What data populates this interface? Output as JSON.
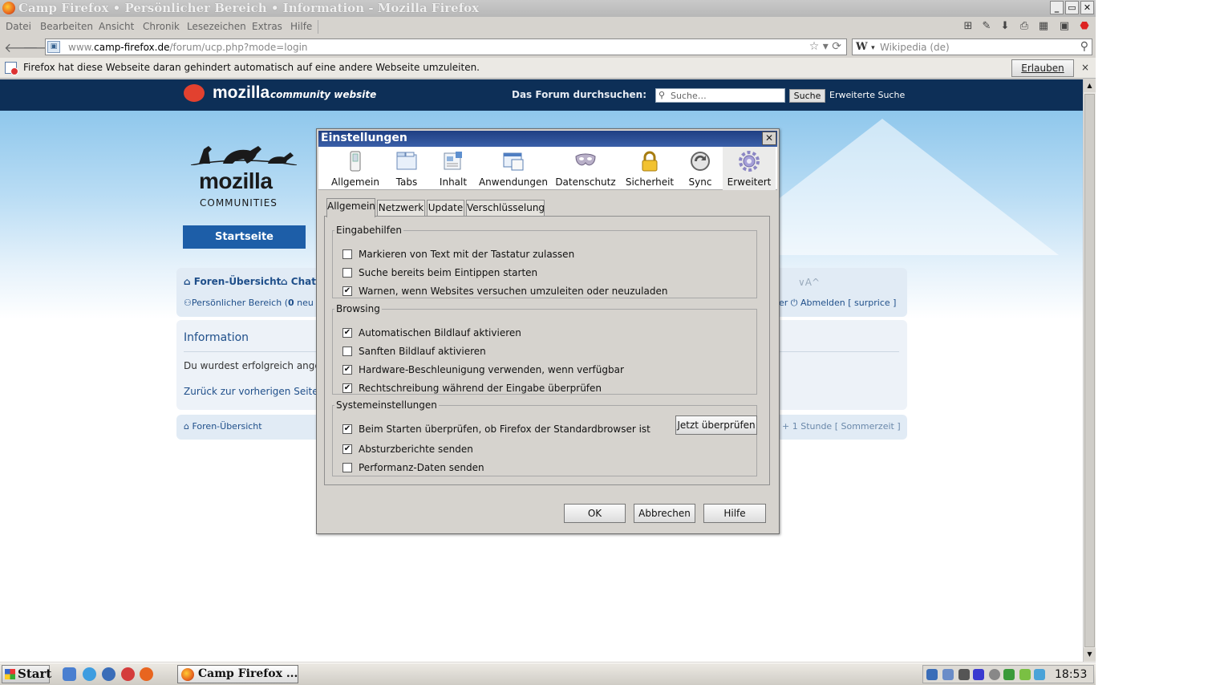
{
  "window": {
    "title": "Camp Firefox • Persönlicher Bereich • Information - Mozilla Firefox",
    "min_label": "_",
    "max_label": "▭",
    "close_label": "✕"
  },
  "menubar": {
    "items": [
      "Datei",
      "Bearbeiten",
      "Ansicht",
      "Chronik",
      "Lesezeichen",
      "Extras",
      "Hilfe"
    ]
  },
  "navbar": {
    "back": "🡐",
    "forward": "🡒",
    "url_prefix": "www.",
    "url_host": "camp-firefox.de",
    "url_path": "/forum/ucp.php?mode=login",
    "url_icons": "☆ ▾  ⟳",
    "search_engine": "W",
    "search_engine_arrow": "▾",
    "search_placeholder": "Wikipedia (de)"
  },
  "notification": {
    "text": "Firefox hat diese Webseite daran gehindert automatisch auf eine andere Webseite umzuleiten.",
    "allow_label": "Erlauben",
    "close": "×"
  },
  "page": {
    "logo_text": "mozilla",
    "logo_sub": "community website",
    "search_label": "Das Forum durchsuchen:",
    "search_placeholder": "Suche…",
    "search_button": "Suche",
    "advanced_search": "Erweiterte Suche",
    "community_word": "mozilla",
    "community_sub": "COMMUNITIES",
    "start_button": "Startseite",
    "nav": {
      "forum_index": "Foren-Übersicht",
      "chat": "Chat",
      "personal_area": "Persönlicher Bereich (",
      "personal_count": "0",
      "personal_suffix": " neu",
      "logout_prefix": "er",
      "logout": "Abmelden [ surprice ]",
      "collapse": "∨A^"
    },
    "info": {
      "heading": "Information",
      "message": "Du wurdest erfolgreich ange",
      "back_link": "Zurück zur vorherigen Seite"
    },
    "footer": {
      "forum_index": "Foren-Übersicht",
      "timezone": "+ 1 Stunde [ Sommerzeit ]"
    }
  },
  "dialog": {
    "title": "Einstellungen",
    "close": "✕",
    "panes": [
      {
        "label": "Allgemein",
        "icon": "switch-icon"
      },
      {
        "label": "Tabs",
        "icon": "tabs-icon"
      },
      {
        "label": "Inhalt",
        "icon": "content-icon"
      },
      {
        "label": "Anwendungen",
        "icon": "applications-icon"
      },
      {
        "label": "Datenschutz",
        "icon": "mask-icon"
      },
      {
        "label": "Sicherheit",
        "icon": "padlock-icon"
      },
      {
        "label": "Sync",
        "icon": "sync-icon"
      },
      {
        "label": "Erweitert",
        "icon": "gear-icon",
        "active": true
      }
    ],
    "tabs": [
      "Allgemein",
      "Netzwerk",
      "Update",
      "Verschlüsselung"
    ],
    "groups": {
      "accessibility": {
        "legend": "Eingabehilfen",
        "items": [
          {
            "label": "Markieren von Text mit der Tastatur zulassen",
            "checked": false
          },
          {
            "label": "Suche bereits beim Eintippen starten",
            "checked": false
          },
          {
            "label": "Warnen, wenn Websites versuchen umzuleiten oder neuzuladen",
            "checked": true
          }
        ]
      },
      "browsing": {
        "legend": "Browsing",
        "items": [
          {
            "label": "Automatischen Bildlauf aktivieren",
            "checked": true
          },
          {
            "label": "Sanften Bildlauf aktivieren",
            "checked": false
          },
          {
            "label": "Hardware-Beschleunigung verwenden, wenn verfügbar",
            "checked": true
          },
          {
            "label": "Rechtschreibung während der Eingabe überprüfen",
            "checked": true
          }
        ]
      },
      "system": {
        "legend": "Systemeinstellungen",
        "items": [
          {
            "label": "Beim Starten überprüfen, ob Firefox der Standardbrowser ist",
            "checked": true
          },
          {
            "label": "Absturzberichte senden",
            "checked": true
          },
          {
            "label": "Performanz-Daten senden",
            "checked": false
          }
        ],
        "check_now": "Jetzt überprüfen"
      }
    },
    "buttons": {
      "ok": "OK",
      "cancel": "Abbrechen",
      "help": "Hilfe"
    }
  },
  "taskbar": {
    "start": "Start",
    "task": "Camp Firefox ...",
    "clock": "18:53"
  },
  "colors": {
    "page_header": "#0d2f57",
    "start_button": "#1d5ea8",
    "dialog_title": "#2a4c93",
    "link": "#1f4f8a"
  }
}
